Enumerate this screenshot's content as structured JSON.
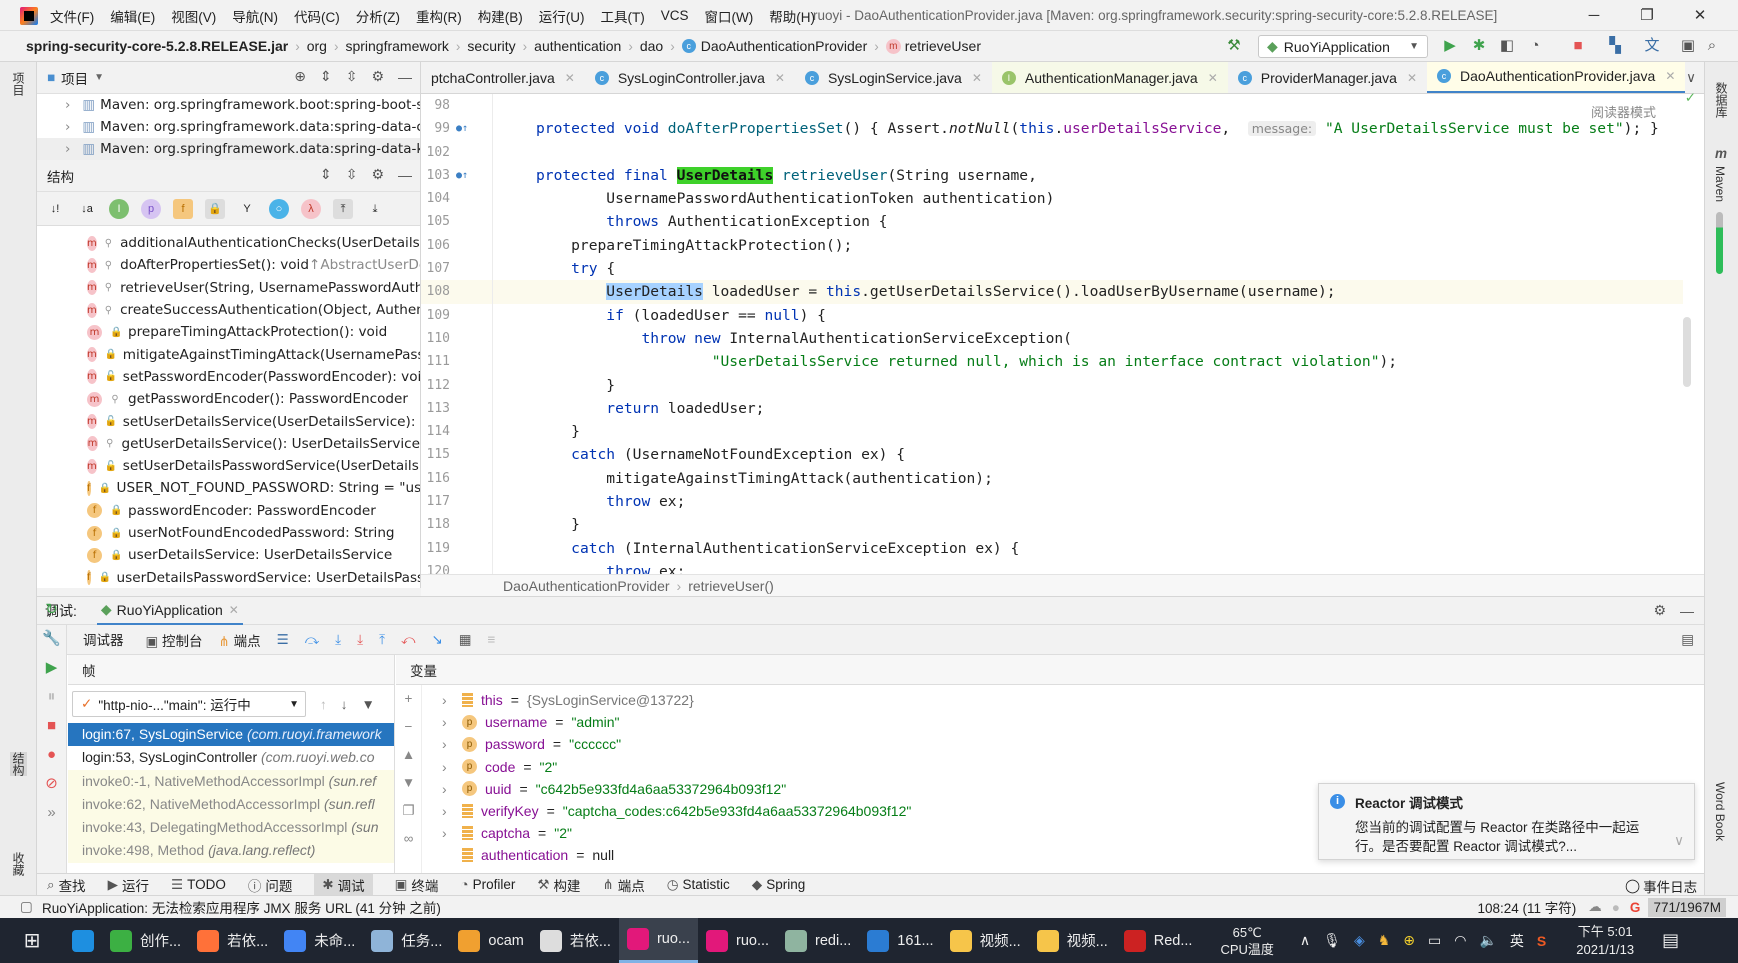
{
  "window": {
    "title": "ruoyi - DaoAuthenticationProvider.java [Maven: org.springframework.security:spring-security-core:5.2.8.RELEASE]",
    "menu": [
      "文件(F)",
      "编辑(E)",
      "视图(V)",
      "导航(N)",
      "代码(C)",
      "分析(Z)",
      "重构(R)",
      "构建(B)",
      "运行(U)",
      "工具(T)",
      "VCS",
      "窗口(W)",
      "帮助(H)"
    ]
  },
  "breadcrumb": [
    "spring-security-core-5.2.8.RELEASE.jar",
    "org",
    "springframework",
    "security",
    "authentication",
    "dao",
    "DaoAuthenticationProvider",
    "retrieveUser"
  ],
  "run_config": "RuoYiApplication",
  "left_strip": {
    "project": "项目",
    "structure": "结构",
    "favorites": "收藏"
  },
  "right_strip": {
    "database": "数据库",
    "maven": "Maven",
    "wordbook": "Word Book"
  },
  "project_panel": {
    "title": "项目",
    "items": [
      "Maven: org.springframework.boot:spring-boot-s",
      "Maven: org.springframework.data:spring-data-cc",
      "Maven: org.springframework.data:spring-data-ke"
    ]
  },
  "structure_panel": {
    "title": "结构",
    "items": [
      {
        "kind": "m",
        "vis": "protected",
        "text": "additionalAuthenticationChecks(UserDetails, U",
        "hint": ""
      },
      {
        "kind": "m",
        "vis": "protected",
        "text": "doAfterPropertiesSet(): void ",
        "hint": "↑AbstractUserDe"
      },
      {
        "kind": "m",
        "vis": "protected",
        "text": "retrieveUser(String, UsernamePasswordAuthe",
        "hint": ""
      },
      {
        "kind": "m",
        "vis": "protected",
        "text": "createSuccessAuthentication(Object, Authent",
        "hint": ""
      },
      {
        "kind": "m",
        "vis": "private",
        "text": "prepareTimingAttackProtection(): void",
        "hint": ""
      },
      {
        "kind": "m",
        "vis": "private",
        "text": "mitigateAgainstTimingAttack(UsernamePassw",
        "hint": ""
      },
      {
        "kind": "m",
        "vis": "public",
        "text": "setPasswordEncoder(PasswordEncoder): void",
        "hint": ""
      },
      {
        "kind": "m",
        "vis": "protected",
        "text": "getPasswordEncoder(): PasswordEncoder",
        "hint": ""
      },
      {
        "kind": "m",
        "vis": "public",
        "text": "setUserDetailsService(UserDetailsService): voi",
        "hint": ""
      },
      {
        "kind": "m",
        "vis": "protected",
        "text": "getUserDetailsService(): UserDetailsService",
        "hint": ""
      },
      {
        "kind": "m",
        "vis": "public",
        "text": "setUserDetailsPasswordService(UserDetailsPas",
        "hint": ""
      },
      {
        "kind": "f",
        "vis": "private",
        "text": "USER_NOT_FOUND_PASSWORD: String = \"use",
        "hint": ""
      },
      {
        "kind": "f",
        "vis": "private",
        "text": "passwordEncoder: PasswordEncoder",
        "hint": ""
      },
      {
        "kind": "f",
        "vis": "private",
        "text": "userNotFoundEncodedPassword: String",
        "hint": ""
      },
      {
        "kind": "f",
        "vis": "private",
        "text": "userDetailsService: UserDetailsService",
        "hint": ""
      },
      {
        "kind": "f",
        "vis": "private",
        "text": "userDetailsPasswordService: UserDetailsPassw",
        "hint": ""
      }
    ]
  },
  "editor": {
    "tabs": [
      {
        "label": "ptchaController.java",
        "icon": "c"
      },
      {
        "label": "SysLoginController.java",
        "icon": "c"
      },
      {
        "label": "SysLoginService.java",
        "icon": "c"
      },
      {
        "label": "AuthenticationManager.java",
        "icon": "i"
      },
      {
        "label": "ProviderManager.java",
        "icon": "c"
      },
      {
        "label": "DaoAuthenticationProvider.java",
        "icon": "c",
        "active": true
      }
    ],
    "reader_mode": "阅读器模式",
    "line_numbers": [
      "98",
      "99",
      "102",
      "103",
      "104",
      "105",
      "106",
      "107",
      "108",
      "109",
      "110",
      "111",
      "112",
      "113",
      "114",
      "115",
      "116",
      "117",
      "118",
      "119",
      "120"
    ],
    "current_line_index": 8,
    "lines": [
      [],
      [
        [
          "protected void ",
          "kw"
        ],
        [
          "doAfterPropertiesSet",
          "fn"
        ],
        [
          "() { Assert.",
          ""
        ],
        [
          "notNull",
          "it"
        ],
        [
          "(",
          ""
        ],
        [
          "this",
          "kw"
        ],
        [
          ".",
          ""
        ],
        [
          "userDetailsService",
          "fld"
        ],
        [
          ",  ",
          ""
        ],
        [
          "message:",
          "hint"
        ],
        [
          " ",
          ""
        ],
        [
          "\"A UserDetailsService must be set\"",
          "str"
        ],
        [
          "); }",
          ""
        ]
      ],
      [],
      [
        [
          "protected final ",
          "kw"
        ],
        [
          "UserDetails",
          "hl"
        ],
        [
          " ",
          ""
        ],
        [
          "retrieveUser",
          "fn"
        ],
        [
          "(String username,",
          ""
        ]
      ],
      [
        [
          "        UsernamePasswordAuthenticationToken authentication)",
          ""
        ]
      ],
      [
        [
          "        ",
          ""
        ],
        [
          "throws ",
          "kw"
        ],
        [
          "AuthenticationException {",
          ""
        ]
      ],
      [
        [
          "    prepareTimingAttackProtection();",
          ""
        ]
      ],
      [
        [
          "    ",
          ""
        ],
        [
          "try ",
          "kw"
        ],
        [
          "{",
          ""
        ]
      ],
      [
        [
          "        ",
          ""
        ],
        [
          "UserDetails",
          "sel"
        ],
        [
          " loadedUser = ",
          ""
        ],
        [
          "this",
          "kw"
        ],
        [
          ".getUserDetailsService().loadUserByUsername(username);",
          ""
        ]
      ],
      [
        [
          "        ",
          ""
        ],
        [
          "if ",
          "kw"
        ],
        [
          "(loadedUser == ",
          ""
        ],
        [
          "null",
          "kw"
        ],
        [
          ") {",
          ""
        ]
      ],
      [
        [
          "            ",
          ""
        ],
        [
          "throw new ",
          "kw"
        ],
        [
          "InternalAuthenticationServiceException(",
          ""
        ]
      ],
      [
        [
          "                    ",
          ""
        ],
        [
          "\"UserDetailsService returned null, which is an interface contract violation\"",
          "str"
        ],
        [
          ");",
          ""
        ]
      ],
      [
        [
          "        }",
          ""
        ]
      ],
      [
        [
          "        ",
          ""
        ],
        [
          "return ",
          "kw"
        ],
        [
          "loadedUser;",
          ""
        ]
      ],
      [
        [
          "    }",
          ""
        ]
      ],
      [
        [
          "    ",
          ""
        ],
        [
          "catch ",
          "kw"
        ],
        [
          "(UsernameNotFoundException ex) {",
          ""
        ]
      ],
      [
        [
          "        mitigateAgainstTimingAttack(authentication);",
          ""
        ]
      ],
      [
        [
          "        ",
          ""
        ],
        [
          "throw ",
          "kw"
        ],
        [
          "ex;",
          ""
        ]
      ],
      [
        [
          "    }",
          ""
        ]
      ],
      [
        [
          "    ",
          ""
        ],
        [
          "catch ",
          "kw"
        ],
        [
          "(InternalAuthenticationServiceException ex) {",
          ""
        ]
      ],
      [
        [
          "        ",
          ""
        ],
        [
          "throw ",
          "kw"
        ],
        [
          "ex;",
          ""
        ]
      ]
    ],
    "crumb": [
      "DaoAuthenticationProvider",
      "retrieveUser()"
    ]
  },
  "debug": {
    "label": "调试:",
    "session": "RuoYiApplication",
    "tabs": [
      "调试器",
      "控制台",
      "端点"
    ],
    "frames_title": "帧",
    "variables_title": "变量",
    "thread": "\"http-nio-...\"main\": 运行中",
    "frames": [
      {
        "method": "login:67, SysLoginService ",
        "pkg": "(com.ruoyi.framework",
        "selected": true
      },
      {
        "method": "login:53, SysLoginController ",
        "pkg": "(com.ruoyi.web.co"
      },
      {
        "method": "invoke0:-1, NativeMethodAccessorImpl ",
        "pkg": "(sun.ref",
        "lib": true
      },
      {
        "method": "invoke:62, NativeMethodAccessorImpl ",
        "pkg": "(sun.refl",
        "lib": true
      },
      {
        "method": "invoke:43, DelegatingMethodAccessorImpl ",
        "pkg": "(sun",
        "lib": true
      },
      {
        "method": "invoke:498, Method ",
        "pkg": "(java.lang.reflect)",
        "lib": true
      }
    ],
    "variables": [
      {
        "icon": "field",
        "name": "this",
        "value": "{SysLoginService@13722}",
        "type": "obj",
        "expand": true
      },
      {
        "icon": "p",
        "name": "username",
        "value": "\"admin\"",
        "type": "str",
        "expand": true
      },
      {
        "icon": "p",
        "name": "password",
        "value": "\"cccccc\"",
        "type": "str",
        "expand": true
      },
      {
        "icon": "p",
        "name": "code",
        "value": "\"2\"",
        "type": "str",
        "expand": true
      },
      {
        "icon": "p",
        "name": "uuid",
        "value": "\"c642b5e933fd4a6aa53372964b093f12\"",
        "type": "str",
        "expand": true
      },
      {
        "icon": "field",
        "name": "verifyKey",
        "value": "\"captcha_codes:c642b5e933fd4a6aa53372964b093f12\"",
        "type": "str",
        "expand": true
      },
      {
        "icon": "field",
        "name": "captcha",
        "value": "\"2\"",
        "type": "str",
        "expand": true
      },
      {
        "icon": "field",
        "name": "authentication",
        "value": "null",
        "type": "null",
        "expand": false
      }
    ]
  },
  "notification": {
    "title": "Reactor 调试模式",
    "body": "您当前的调试配置与 Reactor 在类路径中一起运行。是否要配置 Reactor 调试模式?..."
  },
  "tool_tabs": [
    "查找",
    "运行",
    "TODO",
    "问题",
    "调试",
    "终端",
    "Profiler",
    "构建",
    "端点",
    "Statistic",
    "Spring"
  ],
  "active_tool_tab": 4,
  "event_log": "事件日志",
  "status": {
    "message": "RuoYiApplication: 无法检索应用程序 JMX 服务 URL (41 分钟 之前)",
    "position": "108:24 (11 字符)",
    "memory": "771/1967M"
  },
  "taskbar": {
    "apps": [
      {
        "label": "",
        "color": "#1e8fe0"
      },
      {
        "label": "创作...",
        "color": "#3cb043"
      },
      {
        "label": "若依...",
        "color": "#ff7139"
      },
      {
        "label": "未命...",
        "color": "#4285f4"
      },
      {
        "label": "任务...",
        "color": "#8fb4d8"
      },
      {
        "label": "ocam",
        "color": "#f0a030"
      },
      {
        "label": "若依...",
        "color": "#dddddd"
      },
      {
        "label": "ruo...",
        "color": "#e2187a",
        "active": true
      },
      {
        "label": "ruo...",
        "color": "#e2187a"
      },
      {
        "label": "redi...",
        "color": "#8fb4a0"
      },
      {
        "label": "161...",
        "color": "#2b7cd3"
      },
      {
        "label": "视频...",
        "color": "#f6c54a"
      },
      {
        "label": "视频...",
        "color": "#f6c54a"
      },
      {
        "label": "Red...",
        "color": "#cc2222"
      }
    ],
    "cpu_temp": "65℃",
    "cpu_label": "CPU温度",
    "ime": "英",
    "time": "下午 5:01",
    "date": "2021/1/13"
  }
}
